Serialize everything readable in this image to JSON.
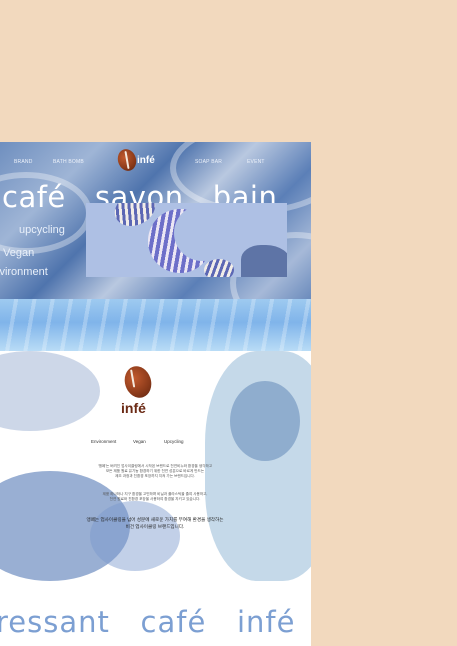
{
  "nav": {
    "brand": "BRAND",
    "bath_bomb": "BATH BOMB",
    "soap_bar": "SOAP BAR",
    "event": "EVENT",
    "logo_text": "infé"
  },
  "hero": {
    "title": "café   savon   bain",
    "tags": [
      "upcycling",
      "Vegan",
      "Environment"
    ]
  },
  "about": {
    "logo_text": "infé",
    "pills": [
      "Environment",
      "Vegan",
      "Upcycling"
    ],
    "paragraph_1": [
      "'앵페'는 버려진 업사이클링에서 시작된 브랜드로 천연비누와 환경을 생각하고",
      "모든 제품 원료 유기농 환경하기 위한 천연 성분으로 바르게 만드는",
      "제조 과정과 친환경 포장까지 지켜 가는 브랜드입니다."
    ],
    "paragraph_2": [
      "제품 하나하나 지구 환경을 고민하며 비닐과 플라스틱을 줄여 사용하고,",
      "천연 원료와 친환경 포장을 사용하여 환경을 지키고 있습니다."
    ],
    "paragraph_strong": [
      "앵페는 업사이클링을 넘어 성분에 새로운 가치를 부여해 환경을 생각하는",
      "비건 업사이클링 브랜드입니다."
    ]
  },
  "footer": {
    "slogan": "ressant   café   infé"
  },
  "colors": {
    "page_bg": "#f2d9be",
    "slogan": "#7c9fd2",
    "logo_brown": "#8b3a1a"
  }
}
